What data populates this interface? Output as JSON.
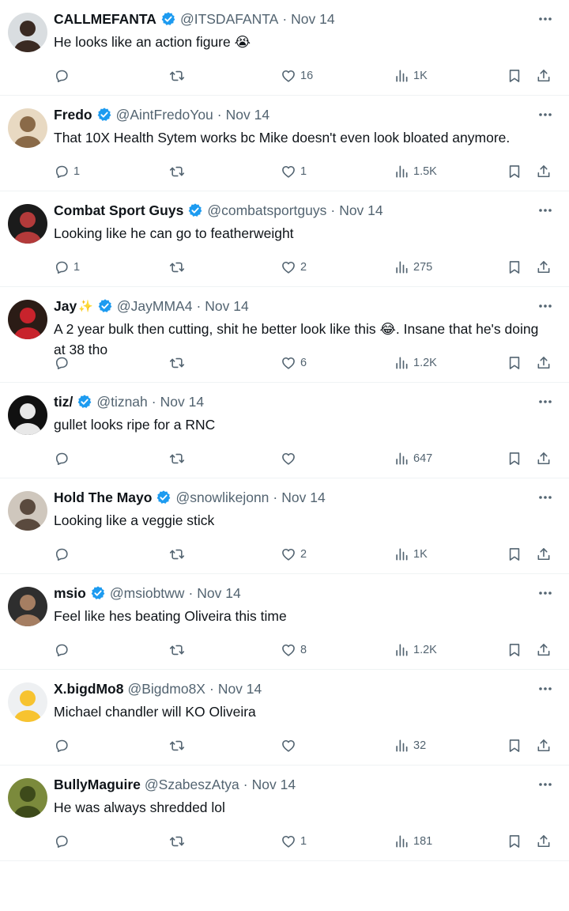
{
  "feed": {
    "items": [
      {
        "name": "CALLMEFANTA",
        "name_emoji": "",
        "verified": true,
        "handle": "@ITSDAFANTA",
        "separator": "·",
        "date": "Nov 14",
        "text": "He looks like an action figure 😭",
        "replies": "",
        "retweets": "",
        "likes": "16",
        "views": "1K",
        "avatar": {
          "bg": "#d9dde0",
          "fg": "#3a2a22"
        }
      },
      {
        "name": "Fredo",
        "name_emoji": "",
        "verified": true,
        "handle": "@AintFredoYou",
        "separator": "·",
        "date": "Nov 14",
        "text": "That 10X Health Sytem works bc Mike doesn't even look bloated anymore.",
        "replies": "1",
        "retweets": "",
        "likes": "1",
        "views": "1.5K",
        "avatar": {
          "bg": "#e8d9c2",
          "fg": "#8a6a48"
        }
      },
      {
        "name": "Combat Sport Guys",
        "name_emoji": "",
        "verified": true,
        "handle": "@combatsportguys",
        "separator": "·",
        "date": "Nov 14",
        "text": "Looking like he can go to featherweight",
        "replies": "1",
        "retweets": "",
        "likes": "2",
        "views": "275",
        "avatar": {
          "bg": "#1b1b1b",
          "fg": "#b33a3a"
        }
      },
      {
        "name": "Jay",
        "name_emoji": "✨",
        "verified": true,
        "handle": "@JayMMA4",
        "separator": "·",
        "date": "Nov 14",
        "text": "A 2 year bulk then cutting, shit he better look like this 😂. Insane that he's doing at 38 tho",
        "replies": "",
        "retweets": "",
        "likes": "6",
        "views": "1.2K",
        "avatar": {
          "bg": "#2b1c16",
          "fg": "#c8232c"
        }
      },
      {
        "name": "tiz/",
        "name_emoji": "",
        "verified": true,
        "handle": "@tiznah",
        "separator": "·",
        "date": "Nov 14",
        "text": "gullet looks ripe for a RNC",
        "replies": "",
        "retweets": "",
        "likes": "",
        "views": "647",
        "avatar": {
          "bg": "#111111",
          "fg": "#e8e8e8"
        }
      },
      {
        "name": "Hold The Mayo",
        "name_emoji": "",
        "verified": true,
        "handle": "@snowlikejonn",
        "separator": "·",
        "date": "Nov 14",
        "text": "Looking like a veggie stick",
        "replies": "",
        "retweets": "",
        "likes": "2",
        "views": "1K",
        "avatar": {
          "bg": "#cfc7bd",
          "fg": "#5a4a3e"
        }
      },
      {
        "name": "msio",
        "name_emoji": "",
        "verified": true,
        "handle": "@msiobtww",
        "separator": "·",
        "date": "Nov 14",
        "text": "Feel like hes beating Oliveira this time",
        "replies": "",
        "retweets": "",
        "likes": "8",
        "views": "1.2K",
        "avatar": {
          "bg": "#2e2e2e",
          "fg": "#a57e62"
        }
      },
      {
        "name": "X.bigdMo8",
        "name_emoji": "",
        "verified": false,
        "handle": "@Bigdmo8X",
        "separator": "·",
        "date": "Nov 14",
        "text": "Michael chandler will KO Oliveira",
        "replies": "",
        "retweets": "",
        "likes": "",
        "views": "32",
        "avatar": {
          "bg": "#eef0f2",
          "fg": "#f7c330"
        }
      },
      {
        "name": "BullyMaguire",
        "name_emoji": "",
        "verified": false,
        "handle": "@SzabeszAtya",
        "separator": "·",
        "date": "Nov 14",
        "text": "He was always shredded lol",
        "replies": "",
        "retweets": "",
        "likes": "1",
        "views": "181",
        "avatar": {
          "bg": "#7b8a3c",
          "fg": "#3d4a1a"
        }
      }
    ]
  },
  "icons": {
    "more": "more-dots-icon",
    "verified": "verified-badge-icon",
    "reply": "reply-bubble-icon",
    "retweet": "retweet-icon",
    "like": "heart-icon",
    "views": "views-chart-icon",
    "bookmark": "bookmark-icon",
    "share": "share-icon"
  },
  "colors": {
    "text": "#0f1419",
    "secondary": "#536471",
    "verified": "#1d9bf0",
    "divider": "#eff3f4"
  }
}
